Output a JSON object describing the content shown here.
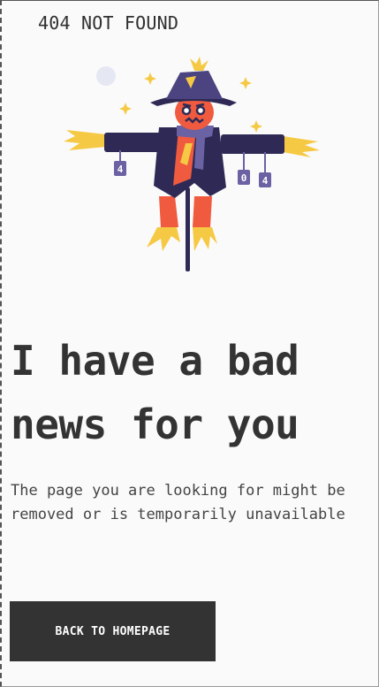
{
  "header": {
    "title": "404 NOT FOUND"
  },
  "illustration": {
    "icon": "scarecrow-illustration",
    "can_digits": [
      "4",
      "0",
      "4"
    ]
  },
  "main": {
    "headline": "I have a bad news for you",
    "description": "The page you are looking for might be removed or is temporarily unavailable",
    "cta_label": "BACK TO HOMEPAGE"
  },
  "colors": {
    "background": "#fafafa",
    "text": "#333333",
    "button_bg": "#333333",
    "button_text": "#ffffff",
    "coat": "#2e2a55",
    "head": "#f05a3f",
    "straw": "#f6c944"
  }
}
